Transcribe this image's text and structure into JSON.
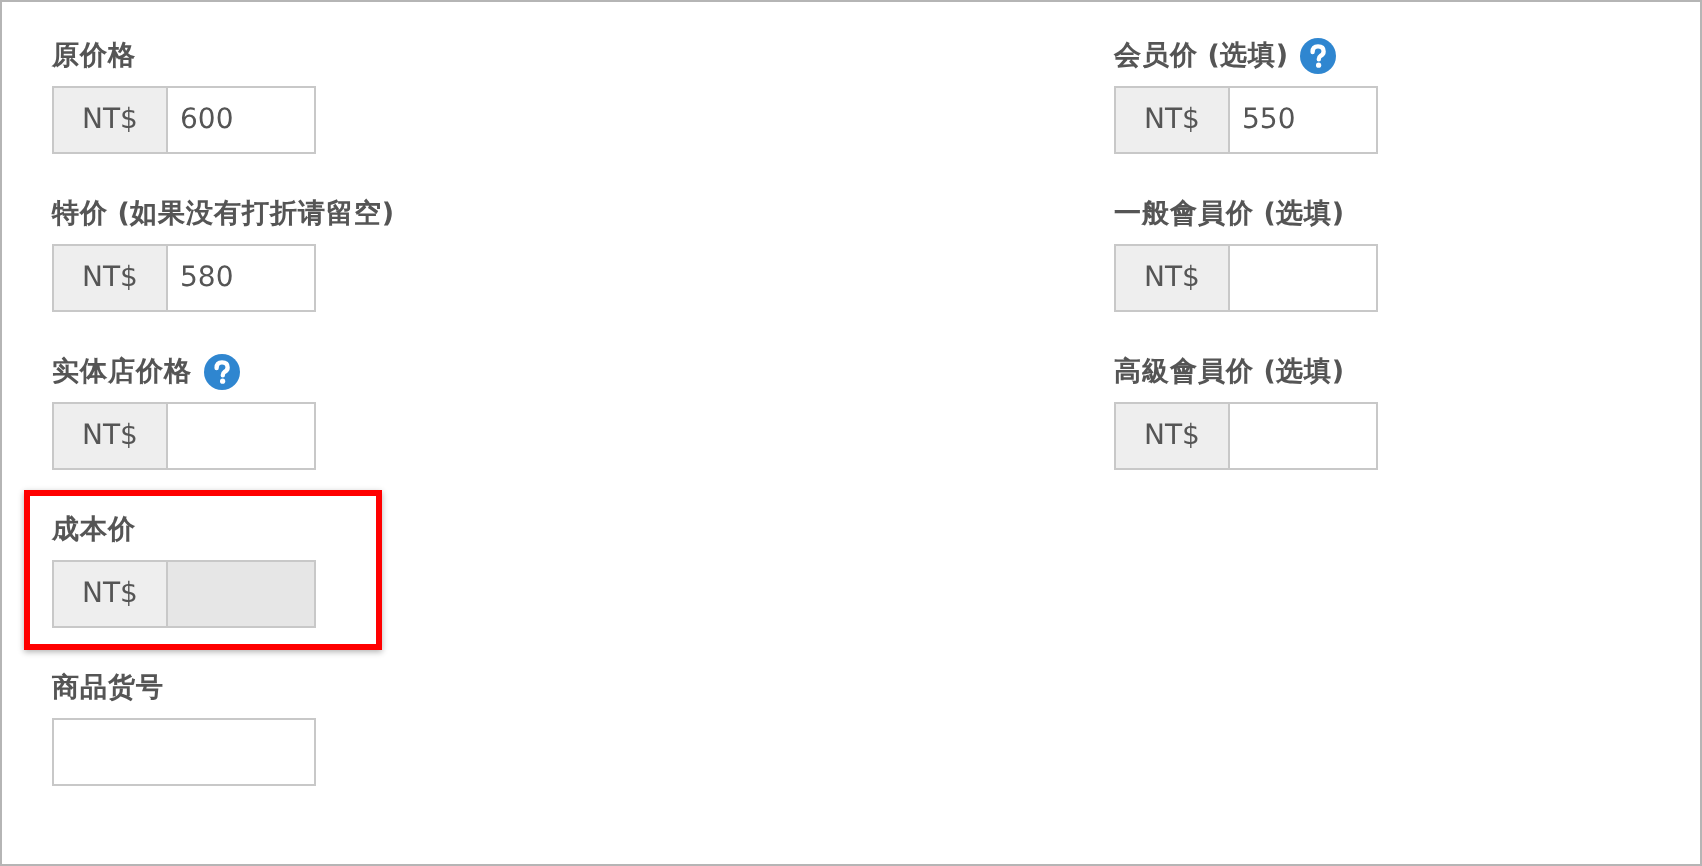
{
  "columns": [
    {
      "fields": [
        {
          "label": "原价格",
          "help": false,
          "prefix": "NT$",
          "value": "600",
          "disabled": false,
          "highlighted": false
        },
        {
          "label": "特价 (如果没有打折请留空)",
          "help": false,
          "prefix": "NT$",
          "value": "580",
          "disabled": false,
          "highlighted": false
        },
        {
          "label": "实体店价格",
          "help": true,
          "prefix": "NT$",
          "disabled": false,
          "highlighted": false
        },
        {
          "label": "成本价",
          "help": false,
          "prefix": "NT$",
          "disabled": true,
          "highlighted": true
        },
        {
          "label": "商品货号",
          "help": false,
          "disabled": false,
          "highlighted": false
        }
      ]
    },
    {
      "fields": [
        {
          "label": "会员价 (选填)",
          "help": true,
          "prefix": "NT$",
          "value": "550",
          "disabled": false,
          "highlighted": false
        },
        {
          "label": "一般會員价 (选填)",
          "help": false,
          "prefix": "NT$",
          "disabled": false,
          "highlighted": false
        },
        {
          "label": "高級會員价 (选填)",
          "help": false,
          "prefix": "NT$",
          "disabled": false,
          "highlighted": false
        }
      ]
    }
  ]
}
